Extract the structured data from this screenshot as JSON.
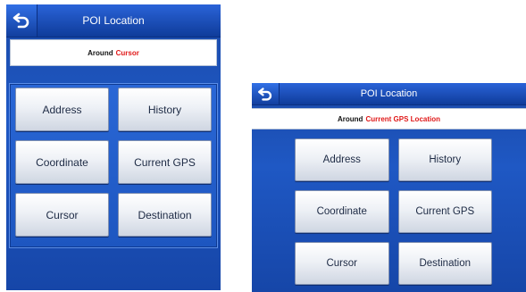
{
  "left_screen": {
    "title": "POI Location",
    "around": {
      "prefix": "Around",
      "target": "Cursor"
    },
    "buttons": [
      {
        "label": "Address"
      },
      {
        "label": "History"
      },
      {
        "label": "Coordinate"
      },
      {
        "label": "Current GPS"
      },
      {
        "label": "Cursor"
      },
      {
        "label": "Destination"
      }
    ]
  },
  "right_screen": {
    "title": "POI Location",
    "around": {
      "prefix": "Around",
      "target": "Current GPS Location"
    },
    "buttons": [
      {
        "label": "Address"
      },
      {
        "label": "History"
      },
      {
        "label": "Coordinate"
      },
      {
        "label": "Current GPS"
      },
      {
        "label": "Cursor"
      },
      {
        "label": "Destination"
      }
    ]
  },
  "icons": {
    "back": "back-arrow-icon"
  },
  "colors": {
    "title_bar": "#1f58c4",
    "highlight_text": "#e01818",
    "button_face": "#eef1f6"
  }
}
